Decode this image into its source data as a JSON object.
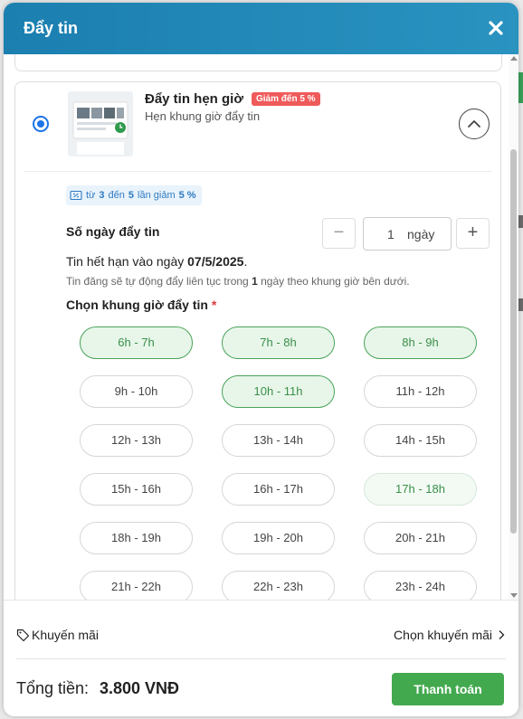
{
  "header": {
    "title": "Đẩy tin",
    "close_icon": "close-icon"
  },
  "option": {
    "title": "Đẩy tin hẹn giờ",
    "badge": "Giảm đến 5 %",
    "subtitle": "Hẹn khung giờ đẩy tin",
    "selected": true
  },
  "promo_tag": {
    "prefix": "từ",
    "from": "3",
    "mid1": "đến",
    "to": "5",
    "mid2": "lần giảm",
    "discount": "5 %"
  },
  "days": {
    "label": "Số ngày đẩy tin",
    "minus": "−",
    "plus": "+",
    "value": "1",
    "unit": "ngày"
  },
  "expiry": {
    "text": "Tin hết hạn vào ngày",
    "date": "07/5/2025",
    "suffix": "."
  },
  "auto_note": {
    "before": "Tin đăng sẽ tự động đẩy liên tục trong",
    "days": "1",
    "after": "ngày theo khung giờ bên dưới."
  },
  "slots_label": "Chọn khung giờ đẩy tin",
  "required_mark": "*",
  "slots": [
    {
      "label": "6h - 7h",
      "state": "selected"
    },
    {
      "label": "7h - 8h",
      "state": "selected"
    },
    {
      "label": "8h - 9h",
      "state": "selected"
    },
    {
      "label": "9h - 10h",
      "state": "normal"
    },
    {
      "label": "10h - 11h",
      "state": "selected"
    },
    {
      "label": "11h - 12h",
      "state": "normal"
    },
    {
      "label": "12h - 13h",
      "state": "normal"
    },
    {
      "label": "13h - 14h",
      "state": "normal"
    },
    {
      "label": "14h - 15h",
      "state": "normal"
    },
    {
      "label": "15h - 16h",
      "state": "normal"
    },
    {
      "label": "16h - 17h",
      "state": "normal"
    },
    {
      "label": "17h - 18h",
      "state": "hover"
    },
    {
      "label": "18h - 19h",
      "state": "normal"
    },
    {
      "label": "19h - 20h",
      "state": "normal"
    },
    {
      "label": "20h - 21h",
      "state": "normal"
    },
    {
      "label": "21h - 22h",
      "state": "normal"
    },
    {
      "label": "22h - 23h",
      "state": "normal"
    },
    {
      "label": "23h - 24h",
      "state": "normal"
    }
  ],
  "footer": {
    "promo_label": "Khuyến mãi",
    "promo_action": "Chọn khuyến mãi",
    "total_label": "Tổng tiền:",
    "total_value": "3.800 VNĐ",
    "pay_label": "Thanh toán"
  },
  "colors": {
    "header": "#1b7fb0",
    "accent_green": "#43a94f",
    "badge_red": "#ef5a5a",
    "radio_blue": "#1e74e8"
  }
}
